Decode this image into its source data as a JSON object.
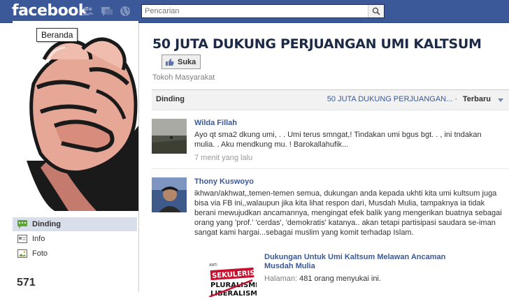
{
  "topbar": {
    "logo": "facebook",
    "search_placeholder": "Pencarian"
  },
  "tooltip": "Beranda",
  "nav": [
    {
      "label": "Dinding",
      "icon": "wall-icon",
      "active": true
    },
    {
      "label": "Info",
      "icon": "info-icon",
      "active": false
    },
    {
      "label": "Foto",
      "icon": "photo-icon",
      "active": false
    }
  ],
  "likes_count": "571",
  "page": {
    "title": "50 JUTA DUKUNG PERJUANGAN UMI KALTSUM",
    "like_label": "Suka",
    "category": "Tokoh Masyarakat"
  },
  "tabs": {
    "wall": "Dinding",
    "filter": "50 JUTA DUKUNG PERJUANGAN... ·",
    "sort": "Terbaru"
  },
  "posts": [
    {
      "author": "Wilda Fillah",
      "text": "Ayo qt sma2 dkung umi, . . Umi terus smngat,! Tindakan umi bgus bgt. . , ini tndakan mulia. . Aku mendkung mu. ! Barokallahufik...",
      "time": "7 menit yang lalu"
    },
    {
      "author": "Thony Kuswoyo",
      "text": "ikhwan/akhwat,,temen-temen semua, dukungan anda kepada ukhti kita umi kultsum juga bisa via FB ini,,walaupun jika kita lihat respon dari, Musdah Mulia, tampaknya ia tidak berani mewujudkan ancamannya, mengingat efek balik yang mengerikan buatnya sebagai orang yang 'prof.' 'cerdas', 'demokratis' katanya.. akan tetapi partisipasi saudara se-iman sangat kami hargai...sebagai muslim yang komit terhadap Islam.",
      "share": {
        "title": "Dukungan Untuk Umi Kaltsum Melawan Ancaman Musdah Mulia",
        "meta_key": "Halaman:",
        "meta_value": "481 orang menyukai ini.",
        "image_words": [
          "SEKULERISME",
          "PLURALISME",
          "LIBERALISME"
        ]
      }
    }
  ],
  "colors": {
    "brand": "#3b5998",
    "link": "#3b5998",
    "active_nav": "#d8dfea"
  }
}
